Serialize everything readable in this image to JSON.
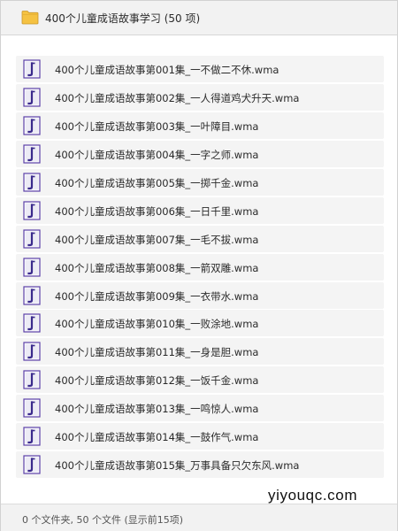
{
  "header": {
    "icon": "folder-icon",
    "title": "400个儿童成语故事学习 (50 项)"
  },
  "files": [
    {
      "name": "400个儿童成语故事第001集_一不做二不休.wma",
      "icon": "audio-file-icon"
    },
    {
      "name": "400个儿童成语故事第002集_一人得道鸡犬升天.wma",
      "icon": "audio-file-icon"
    },
    {
      "name": "400个儿童成语故事第003集_一叶障目.wma",
      "icon": "audio-file-icon"
    },
    {
      "name": "400个儿童成语故事第004集_一字之师.wma",
      "icon": "audio-file-icon"
    },
    {
      "name": "400个儿童成语故事第005集_一掷千金.wma",
      "icon": "audio-file-icon"
    },
    {
      "name": "400个儿童成语故事第006集_一日千里.wma",
      "icon": "audio-file-icon"
    },
    {
      "name": "400个儿童成语故事第007集_一毛不拔.wma",
      "icon": "audio-file-icon"
    },
    {
      "name": "400个儿童成语故事第008集_一箭双雕.wma",
      "icon": "audio-file-icon"
    },
    {
      "name": "400个儿童成语故事第009集_一衣带水.wma",
      "icon": "audio-file-icon"
    },
    {
      "name": "400个儿童成语故事第010集_一败涂地.wma",
      "icon": "audio-file-icon"
    },
    {
      "name": "400个儿童成语故事第011集_一身是胆.wma",
      "icon": "audio-file-icon"
    },
    {
      "name": "400个儿童成语故事第012集_一饭千金.wma",
      "icon": "audio-file-icon"
    },
    {
      "name": "400个儿童成语故事第013集_一鸣惊人.wma",
      "icon": "audio-file-icon"
    },
    {
      "name": "400个儿童成语故事第014集_一鼓作气.wma",
      "icon": "audio-file-icon"
    },
    {
      "name": "400个儿童成语故事第015集_万事具备只欠东风.wma",
      "icon": "audio-file-icon"
    }
  ],
  "watermark": "yiyouqc.com",
  "footer": {
    "summary": "0 个文件夹, 50 个文件 (显示前15项)"
  },
  "colors": {
    "folder": "#f5c242",
    "audio_icon": "#5b3fa8",
    "row_bg": "#f4f4f4"
  }
}
